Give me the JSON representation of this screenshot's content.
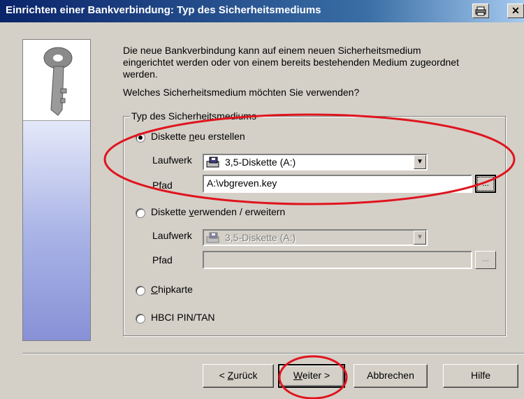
{
  "window": {
    "title": "Einrichten einer Bankverbindung: Typ des Sicherheitsmediums",
    "controls": [
      "print-icon",
      "close-icon"
    ]
  },
  "intro": {
    "line1": "Die neue Bankverbindung kann  auf einem neuen Sicherheitsmedium",
    "line2": "eingerichtet werden oder von einem bereits bestehenden Medium zugeordnet",
    "line3": "werden.",
    "question": "Welches Sicherheitsmedium möchten Sie verwenden?"
  },
  "group": {
    "legend": "Typ des Sicherheitsmediums",
    "option1": {
      "label_a": "Diskette ",
      "label_u": "n",
      "label_b": "eu erstellen",
      "checked": true,
      "laufwerk_label": "Laufwerk",
      "laufwerk_value": "3,5-Diskette (A:)",
      "pfad_label": "Pfad",
      "pfad_value": "A:\\vbgreven.key",
      "browse_label": "..."
    },
    "option2": {
      "label_a": "Diskette ",
      "label_u": "v",
      "label_b": "erwenden / erweitern",
      "checked": false,
      "laufwerk_label": "Laufwerk",
      "laufwerk_value": "3,5-Diskette (A:)",
      "pfad_label": "Pfad",
      "pfad_value": "",
      "browse_label": "..."
    },
    "option3": {
      "label_u": "C",
      "label_b": "hipkarte",
      "checked": false
    },
    "option4": {
      "label": "HBCI PIN/TAN",
      "checked": false
    }
  },
  "buttons": {
    "back_a": "< ",
    "back_u": "Z",
    "back_b": "urück",
    "next_u": "W",
    "next_b": "eiter >",
    "cancel": "Abbrechen",
    "help": "Hilfe"
  },
  "colors": {
    "titlebar_start": "#0a246a",
    "titlebar_end": "#a6caf0",
    "annotation": "#e0141e",
    "dialog_bg": "#d4d0c8"
  }
}
